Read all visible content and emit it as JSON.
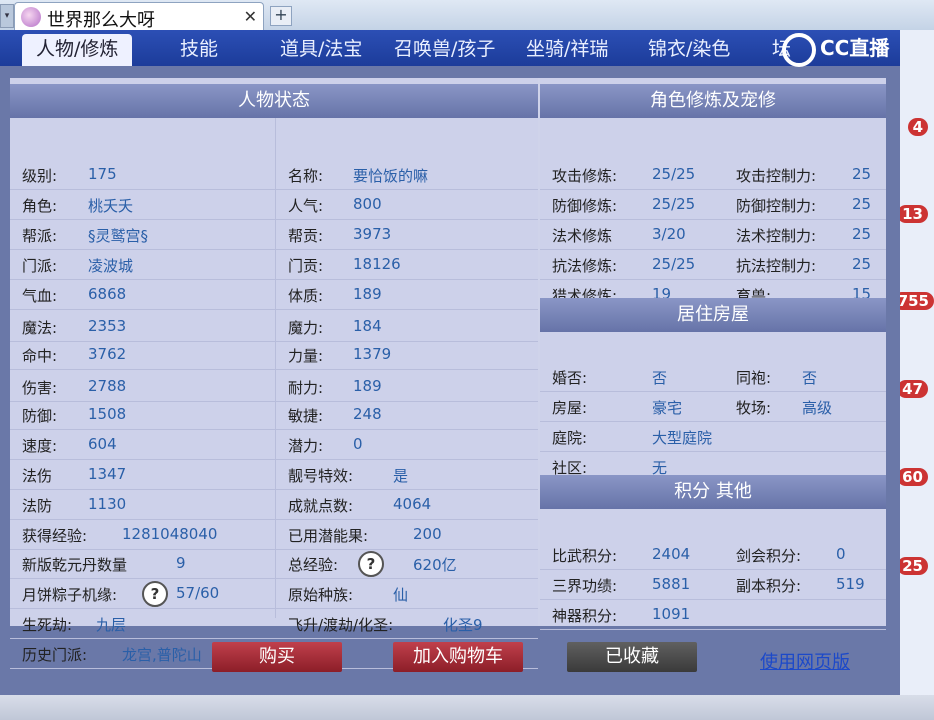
{
  "browser": {
    "tab_title": "世界那么大呀",
    "close_glyph": "✕",
    "new_tab_glyph": "+",
    "arrow_glyph": "▾"
  },
  "nav": {
    "tabs": [
      {
        "label": "人物/修炼",
        "active": true
      },
      {
        "label": "技能",
        "active": false
      },
      {
        "label": "道具/法宝",
        "active": false
      },
      {
        "label": "召唤兽/孩子",
        "active": false
      },
      {
        "label": "坐骑/祥瑞",
        "active": false
      },
      {
        "label": "锦衣/染色",
        "active": false
      },
      {
        "label": "坛",
        "active": false
      }
    ],
    "brand": "CC直播"
  },
  "status": {
    "title": "人物状态",
    "left": [
      {
        "label": "级别:",
        "value": "175"
      },
      {
        "label": "角色:",
        "value": "桃夭夭"
      },
      {
        "label": "帮派:",
        "value": "§灵鹫宫§"
      },
      {
        "label": "门派:",
        "value": "凌波城"
      },
      {
        "label": "气血:",
        "value": "6868"
      },
      {
        "label": "魔法:",
        "value": "2353"
      },
      {
        "label": "命中:",
        "value": "3762"
      },
      {
        "label": "伤害:",
        "value": "2788"
      },
      {
        "label": "防御:",
        "value": "1508"
      },
      {
        "label": "速度:",
        "value": "604"
      },
      {
        "label": "法伤",
        "value": "1347"
      },
      {
        "label": "法防",
        "value": "1130"
      },
      {
        "label": "获得经验:",
        "value": "1281048040"
      },
      {
        "label": "新版乾元丹数量",
        "value": "9"
      },
      {
        "label": "月饼粽子机缘:",
        "value": "57/60"
      },
      {
        "label": "生死劫:",
        "value": "九层"
      },
      {
        "label": "历史门派:",
        "value": "龙宫,普陀山"
      }
    ],
    "right": [
      {
        "label": "名称:",
        "value": "要恰饭的嘛"
      },
      {
        "label": "人气:",
        "value": "800"
      },
      {
        "label": "帮贡:",
        "value": "3973"
      },
      {
        "label": "门贡:",
        "value": "18126"
      },
      {
        "label": "体质:",
        "value": "189"
      },
      {
        "label": "魔力:",
        "value": "184"
      },
      {
        "label": "力量:",
        "value": "1379"
      },
      {
        "label": "耐力:",
        "value": "189"
      },
      {
        "label": "敏捷:",
        "value": "248"
      },
      {
        "label": "潜力:",
        "value": "0"
      },
      {
        "label": "靓号特效:",
        "value": "是"
      },
      {
        "label": "成就点数:",
        "value": "4064"
      },
      {
        "label": "已用潜能果:",
        "value": "200"
      },
      {
        "label": "总经验:",
        "value": "620亿"
      },
      {
        "label": "原始种族:",
        "value": "仙"
      },
      {
        "label": "飞升/渡劫/化圣:",
        "value": "化圣9"
      }
    ],
    "help_glyph": "?"
  },
  "cultivation": {
    "title": "角色修炼及宠修",
    "rows": [
      {
        "l1": "攻击修炼:",
        "v1": "25/25",
        "l2": "攻击控制力:",
        "v2": "25"
      },
      {
        "l1": "防御修炼:",
        "v1": "25/25",
        "l2": "防御控制力:",
        "v2": "25"
      },
      {
        "l1": "法术修炼",
        "v1": "3/20",
        "l2": "法术控制力:",
        "v2": "25"
      },
      {
        "l1": "抗法修炼:",
        "v1": "25/25",
        "l2": "抗法控制力:",
        "v2": "25"
      },
      {
        "l1": "猎术修炼:",
        "v1": "19",
        "l2": "育兽:",
        "v2": "15"
      }
    ]
  },
  "housing": {
    "title": "居住房屋",
    "rows": [
      {
        "l1": "婚否:",
        "v1": "否",
        "l2": "同袍:",
        "v2": "否"
      },
      {
        "l1": "房屋:",
        "v1": "豪宅",
        "l2": "牧场:",
        "v2": "高级"
      },
      {
        "l1": "庭院:",
        "v1": "大型庭院",
        "l2": "",
        "v2": ""
      },
      {
        "l1": "社区:",
        "v1": "无",
        "l2": "",
        "v2": ""
      }
    ]
  },
  "points": {
    "title": "积分 其他",
    "rows": [
      {
        "l1": "比武积分:",
        "v1": "2404",
        "l2": "剑会积分:",
        "v2": "0"
      },
      {
        "l1": "三界功绩:",
        "v1": "5881",
        "l2": "副本积分:",
        "v2": "519"
      },
      {
        "l1": "神器积分:",
        "v1": "1091",
        "l2": "",
        "v2": ""
      }
    ]
  },
  "actions": {
    "buy": "购买",
    "cart": "加入购物车",
    "fav": "已收藏",
    "web": "使用网页版"
  },
  "side_badges": [
    "4",
    "13",
    "755",
    "47",
    "60",
    "25"
  ]
}
